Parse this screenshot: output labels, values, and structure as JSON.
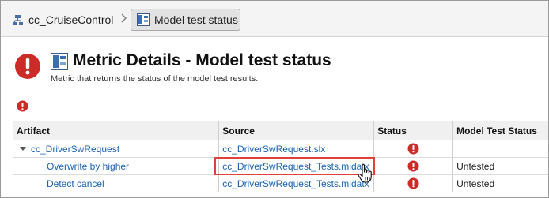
{
  "breadcrumb": {
    "model_label": "cc_CruiseControl",
    "current_label": "Model test status"
  },
  "header": {
    "title": "Metric Details - Model test status",
    "subtitle": "Metric that returns the status of the model test results."
  },
  "colors": {
    "error": "#cc2b27",
    "link": "#1a64b4",
    "highlight": "#e0413b"
  },
  "table": {
    "columns": [
      "Artifact",
      "Source",
      "Status",
      "Model Test Status"
    ],
    "rows": [
      {
        "artifact": "cc_DriverSwRequest",
        "source": "cc_DriverSwRequest.slx",
        "status": "error-icon",
        "model_test_status": ""
      },
      {
        "artifact": "Overwrite by higher",
        "source": "cc_DriverSwRequest_Tests.mldatx",
        "status": "error-icon",
        "model_test_status": "Untested"
      },
      {
        "artifact": "Detect cancel",
        "source": "cc_DriverSwRequest_Tests.mldatx",
        "status": "error-icon",
        "model_test_status": "Untested"
      }
    ]
  }
}
